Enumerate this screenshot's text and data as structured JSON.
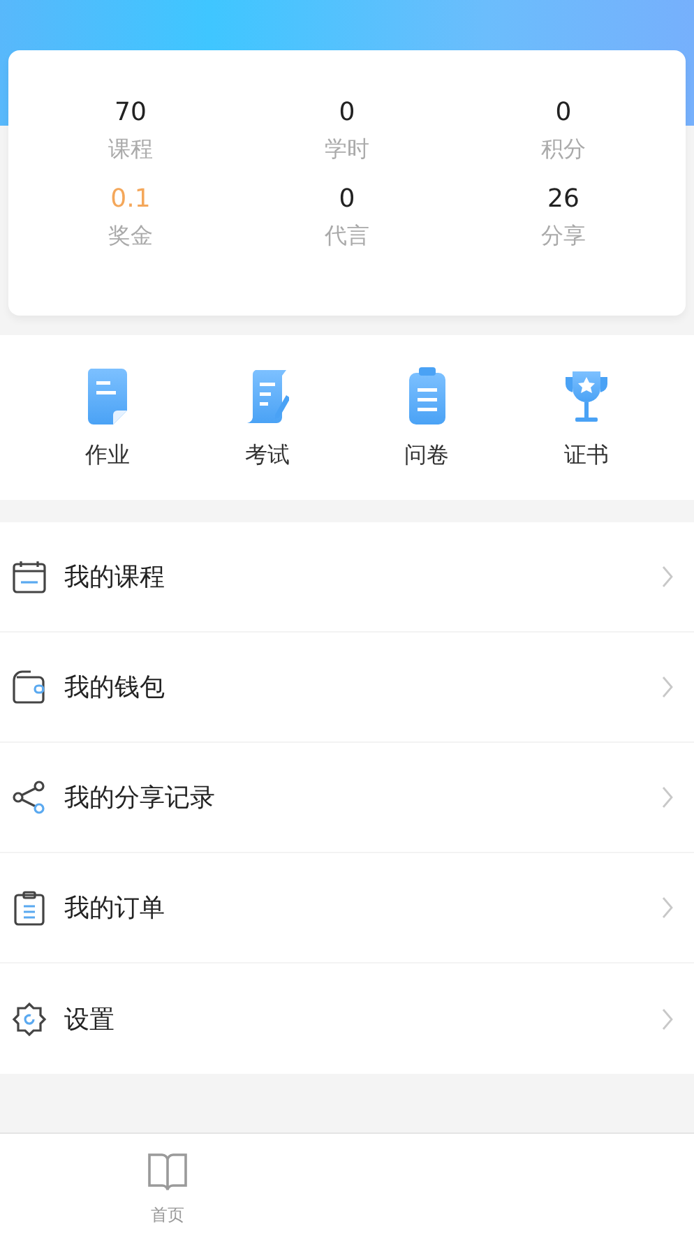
{
  "stats": [
    {
      "value": "70",
      "label": "课程",
      "highlighted": false
    },
    {
      "value": "0",
      "label": "学时",
      "highlighted": false
    },
    {
      "value": "0",
      "label": "积分",
      "highlighted": false
    },
    {
      "value": "0.1",
      "label": "奖金",
      "highlighted": true
    },
    {
      "value": "0",
      "label": "代言",
      "highlighted": false
    },
    {
      "value": "26",
      "label": "分享",
      "highlighted": false
    }
  ],
  "actions": [
    {
      "label": "作业"
    },
    {
      "label": "考试"
    },
    {
      "label": "问卷"
    },
    {
      "label": "证书"
    }
  ],
  "menu": [
    {
      "label": "我的课程"
    },
    {
      "label": "我的钱包"
    },
    {
      "label": "我的分享记录"
    },
    {
      "label": "我的订单"
    },
    {
      "label": "设置"
    }
  ],
  "tab_bar": [
    {
      "label": "首页"
    }
  ]
}
